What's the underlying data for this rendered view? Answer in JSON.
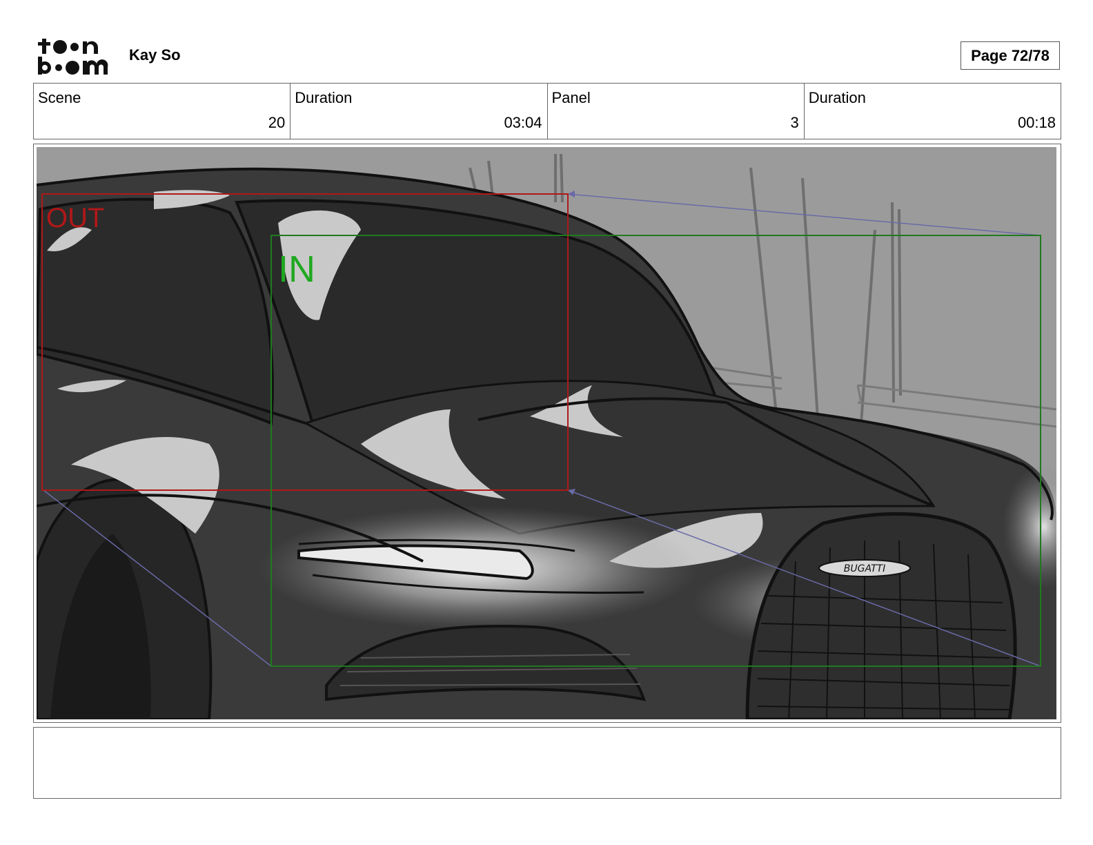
{
  "header": {
    "logo": {
      "line1": "toon",
      "line2": "boom"
    },
    "author": "Kay So",
    "page_label": "Page 72/78"
  },
  "info": {
    "scene_label": "Scene",
    "scene_value": "20",
    "scene_duration_label": "Duration",
    "scene_duration_value": "03:04",
    "panel_label": "Panel",
    "panel_value": "3",
    "panel_duration_label": "Duration",
    "panel_duration_value": "00:18"
  },
  "panel": {
    "out_label": "OUT",
    "in_label": "IN",
    "badge_text": "BUGATTI",
    "out_color": "#b01818",
    "in_color": "#1f7a1f",
    "arrow_color": "#6a6aa8"
  },
  "notes": {
    "text": ""
  }
}
